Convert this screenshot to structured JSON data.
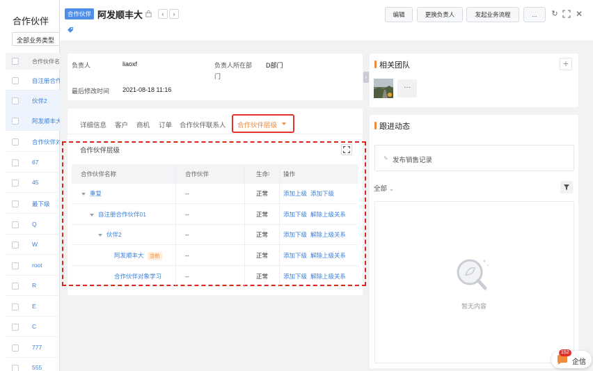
{
  "background": {
    "title": "合作伙伴",
    "filter": "全部业务类型",
    "column_header": "合作伙伴名称",
    "rows": [
      "自注册合作",
      "伙伴2",
      "阿发顺丰大",
      "合作伙伴对",
      "67",
      "45",
      "最下级",
      "Q",
      "W",
      "root",
      "R",
      "E",
      "C",
      "777",
      "555"
    ]
  },
  "modal": {
    "tag": "合作伙伴",
    "title": "阿发顺丰大",
    "toolbar": {
      "edit": "编辑",
      "change_owner": "更换负责人",
      "start_flow": "发起业务流程",
      "more": "..."
    }
  },
  "info": {
    "owner_label": "负责人",
    "owner_value": "liaoxf",
    "dept_label_1": "负责人所在部",
    "dept_label_2": "门",
    "dept_value": "D部门",
    "modified_label": "最后修改时间",
    "modified_value": "2021-08-18 11:16"
  },
  "tabs": [
    "详细信息",
    "客户",
    "商机",
    "订单",
    "合作伙伴联系人"
  ],
  "active_tab": "合作伙伴层级",
  "hierarchy": {
    "title": "合作伙伴层级",
    "columns": [
      "合作伙伴名称",
      "合作伙伴",
      "生命状态",
      "操作"
    ],
    "rows": [
      {
        "name": "重复",
        "partner": "--",
        "status": "正常",
        "op1": "添加上级",
        "op2": "添加下级",
        "current": ""
      },
      {
        "name": "自注册合作伙伴01",
        "partner": "--",
        "status": "正常",
        "op1": "添加下级",
        "op2": "解除上级关系",
        "current": ""
      },
      {
        "name": "伙伴2",
        "partner": "--",
        "status": "正常",
        "op1": "添加下级",
        "op2": "解除上级关系",
        "current": ""
      },
      {
        "name": "阿发顺丰大",
        "partner": "--",
        "status": "正常",
        "op1": "添加下级",
        "op2": "解除上级关系",
        "current": "当前"
      },
      {
        "name": "合作伙伴对象学习",
        "partner": "--",
        "status": "正常",
        "op1": "添加下级",
        "op2": "解除上级关系",
        "current": ""
      }
    ]
  },
  "team": {
    "title": "相关团队",
    "more": "···"
  },
  "activity": {
    "title": "跟进动态",
    "publish": "发布销售记录",
    "filter": "全部",
    "empty": "暂无内容"
  },
  "chat": {
    "badge": "152",
    "label": "企信"
  }
}
